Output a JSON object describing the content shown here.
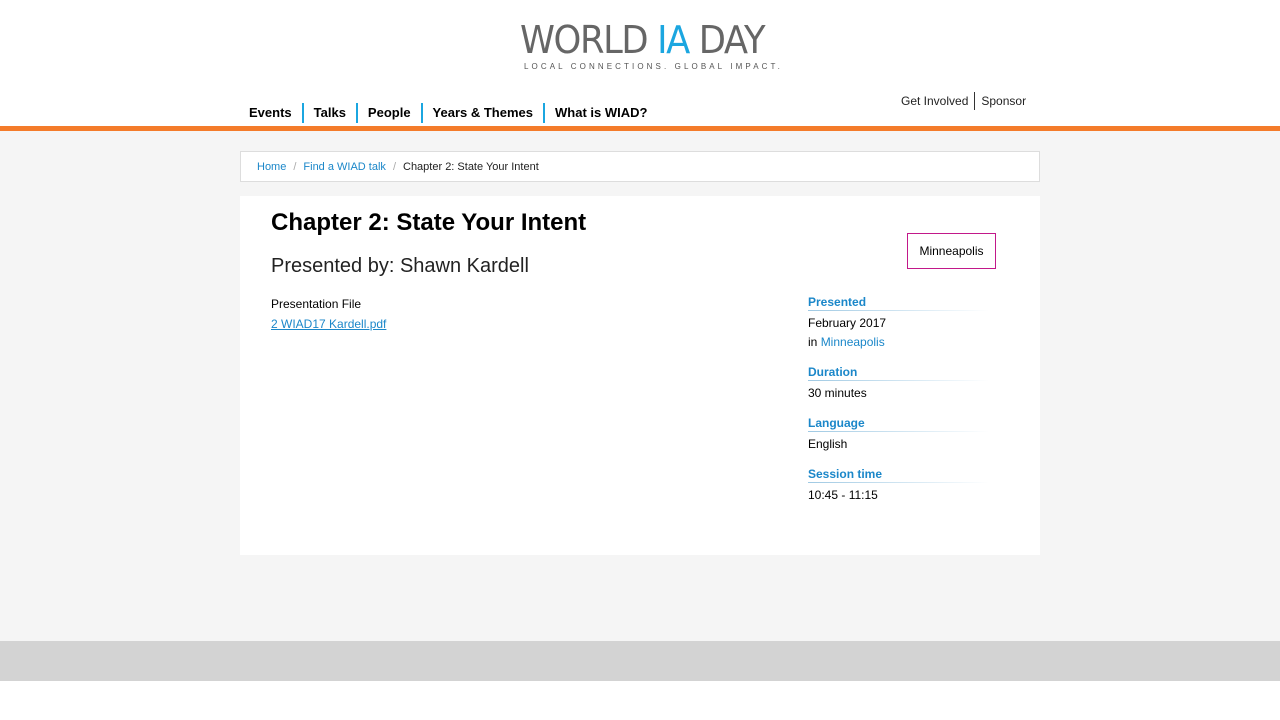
{
  "header": {
    "logo_part1": "WORLD ",
    "logo_part2": "IA",
    "logo_part3": " DAY",
    "tagline": "LOCAL CONNECTIONS. GLOBAL IMPACT.",
    "nav": [
      "Events",
      "Talks",
      "People",
      "Years & Themes",
      "What is WIAD?"
    ],
    "util_nav": [
      "Get Involved",
      "Sponsor"
    ]
  },
  "breadcrumb": {
    "home": "Home",
    "talks": "Find a WIAD talk",
    "current": "Chapter 2: State Your Intent",
    "divider": "/"
  },
  "talk": {
    "title": "Chapter 2: State Your Intent",
    "presenter": "Presented by: Shawn Kardell",
    "file_label": "Presentation File",
    "file_name": "2 WIAD17 Kardell.pdf",
    "city_badge": "Minneapolis"
  },
  "meta": {
    "presented_label": "Presented",
    "presented_date": "February 2017",
    "presented_in": "in ",
    "presented_city": "Minneapolis",
    "duration_label": "Duration",
    "duration_value": "30 minutes",
    "language_label": "Language",
    "language_value": "English",
    "session_label": "Session time",
    "session_value": "10:45 - 11:15"
  },
  "colors": {
    "accent_orange": "#f47b2a",
    "accent_blue": "#1ba6e0",
    "link_blue": "#1b87c9",
    "badge_border": "#c2188a"
  }
}
